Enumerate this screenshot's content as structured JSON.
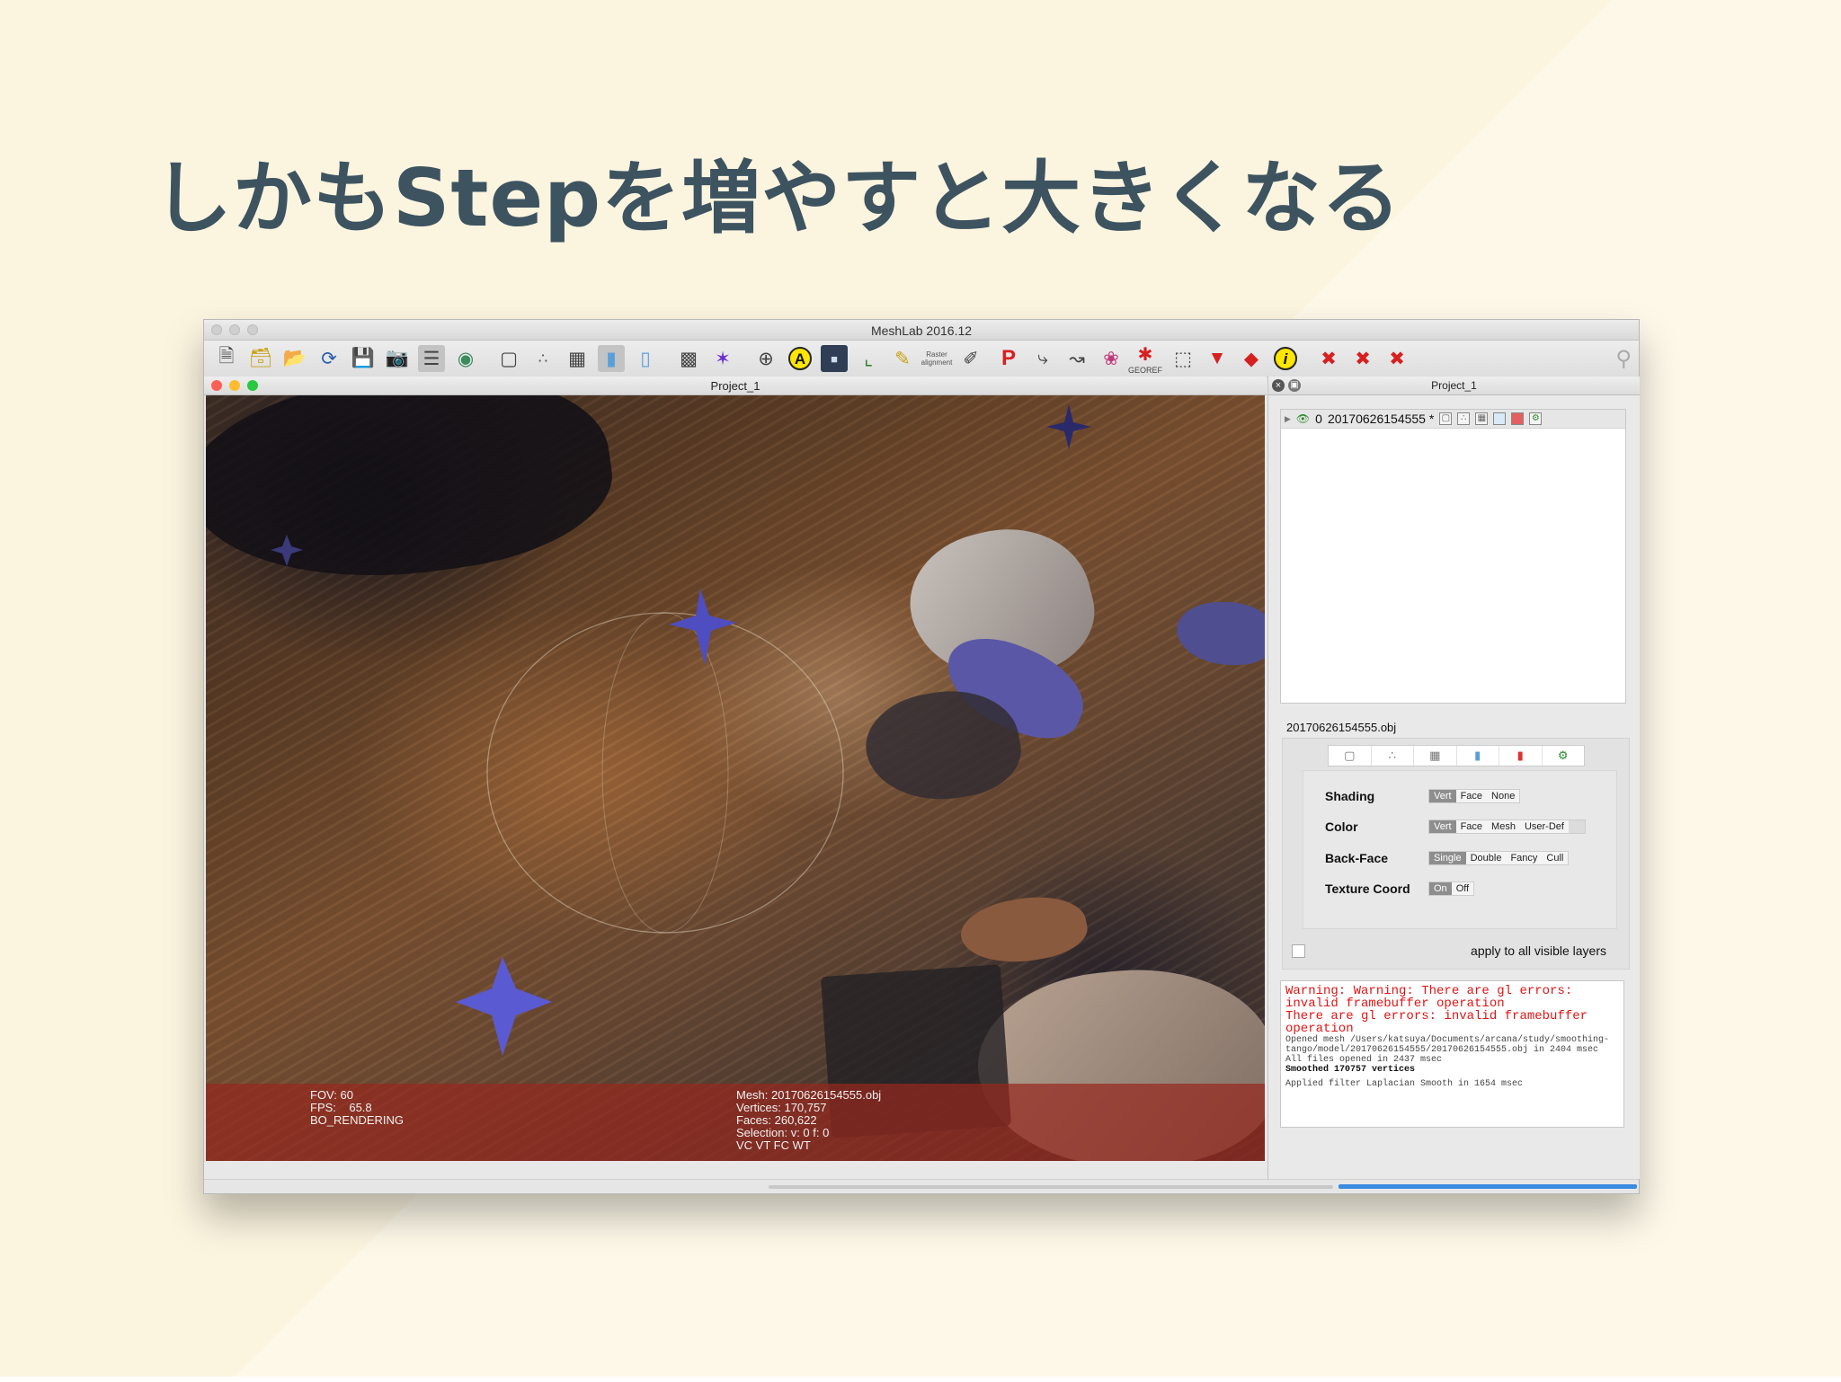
{
  "slide": {
    "title": "しかもStepを増やすと大きくなる"
  },
  "window": {
    "title": "MeshLab 2016.12"
  },
  "toolbar": {
    "icons": [
      "new-document-icon",
      "open-project-icon",
      "open-mesh-icon",
      "reload-icon",
      "save-icon",
      "snapshot-icon",
      "layers-icon",
      "globe-icon",
      "bbox-icon",
      "points-icon",
      "wireframe-icon",
      "smooth-shading-icon",
      "flat-shading-icon",
      "lighting-icon",
      "axes-icon",
      "trackball-icon",
      "annotation-a-icon",
      "raster-icon",
      "frame-icon",
      "paint-icon",
      "brush-icon",
      "pickpoints-icon",
      "select-icon",
      "measure-icon",
      "rabbit-icon",
      "georef-icon",
      "select-vertex-icon",
      "select-face-icon",
      "select-conn-icon",
      "info-icon",
      "delete-icon",
      "delete-vert-icon",
      "delete-face-icon",
      "search-icon"
    ],
    "georef_label": "GEOREF",
    "raster_label": "Raster alignment"
  },
  "viewer": {
    "tab_title": "Project_1",
    "info_left": [
      "FOV: 60",
      "FPS:    65.8",
      "BO_RENDERING"
    ],
    "info_right": [
      "Mesh: 20170626154555.obj",
      "Vertices: 170,757",
      "Faces: 260,622",
      "Selection: v: 0 f: 0",
      "VC VT FC WT"
    ]
  },
  "layers_panel": {
    "title": "Project_1",
    "layer": {
      "index": "0",
      "name": "20170626154555 *"
    }
  },
  "mesh_props": {
    "mesh_name": "20170626154555.obj",
    "shading": {
      "label": "Shading",
      "options": [
        "Vert",
        "Face",
        "None"
      ],
      "selected": "Vert"
    },
    "color": {
      "label": "Color",
      "options": [
        "Vert",
        "Face",
        "Mesh",
        "User-Def"
      ],
      "selected": "Vert"
    },
    "backface": {
      "label": "Back-Face",
      "options": [
        "Single",
        "Double",
        "Fancy",
        "Cull"
      ],
      "selected": "Single"
    },
    "texcoord": {
      "label": "Texture Coord",
      "options": [
        "On",
        "Off"
      ],
      "selected": "On"
    },
    "apply_all": "apply to all visible layers"
  },
  "log": {
    "warn1": "Warning: Warning: There are gl errors: invalid framebuffer operation",
    "warn2": "There are gl errors: invalid framebuffer operation",
    "opened": "Opened mesh /Users/katsuya/Documents/arcana/study/smoothing-tango/model/20170626154555/20170626154555.obj in 2404 msec",
    "all_opened": "All files opened in 2437 msec",
    "smoothed": "Smoothed 170757 vertices",
    "applied": "Applied filter Laplacian Smooth in 1654 msec"
  },
  "colors": {
    "title": "#3d5360",
    "error": "#e01414",
    "info_bar": "#96281e",
    "progress": "#3b8be0"
  },
  "progress": {
    "fraction": 0.79
  }
}
